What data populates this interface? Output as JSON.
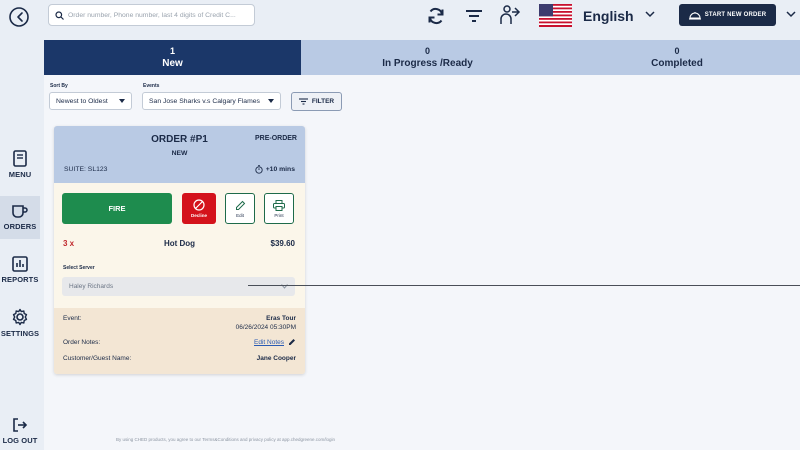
{
  "search": {
    "placeholder": "Order number, Phone number, last 4 digits of Credit C..."
  },
  "header": {
    "language": "English",
    "start_order_label": "START NEW ORDER"
  },
  "sidebar": {
    "items": [
      {
        "label": "MENU",
        "icon": "book-icon"
      },
      {
        "label": "ORDERS",
        "icon": "coffee-cup-icon"
      },
      {
        "label": "REPORTS",
        "icon": "bar-chart-icon"
      },
      {
        "label": "SETTINGS",
        "icon": "gear-icon"
      },
      {
        "label": "LOG OUT",
        "icon": "logout-icon"
      }
    ]
  },
  "tabs": [
    {
      "count": "1",
      "label": "New"
    },
    {
      "count": "0",
      "label": "In Progress /Ready"
    },
    {
      "count": "0",
      "label": "Completed"
    }
  ],
  "filters": {
    "sort_label": "Sort By",
    "sort_value": "Newest to Oldest",
    "events_label": "Events",
    "events_value": "San Jose Sharks v.s Calgary Flames",
    "filter_button": "FILTER"
  },
  "order": {
    "number": "ORDER #P1",
    "type": "PRE-ORDER",
    "status": "NEW",
    "suite": "SUITE: SL123",
    "time": "+10 mins",
    "fire_label": "FIRE",
    "decline_label": "Decline",
    "edit_label": "Edit",
    "print_label": "Print",
    "item": {
      "qty": "3 x",
      "name": "Hot Dog",
      "price": "$39.60"
    },
    "server_label": "Select Server",
    "server_value": "Haley Richards",
    "event_label": "Event:",
    "event_name": "Eras Tour",
    "event_date": "06/26/2024 05:30PM",
    "notes_label": "Order Notes:",
    "edit_notes": "Edit Notes",
    "customer_label": "Customer/Guest Name:",
    "customer_name": "Jane Cooper"
  },
  "footer": {
    "terms": "By using CHED products, you agree to our Terms&Conditions and privacy policy at app.chedgreene.com/login"
  },
  "colors": {
    "navy": "#1b2a47",
    "tab_active": "#1b3769",
    "tab_inactive": "#b9cae4",
    "fire_green": "#1e8c4e",
    "decline_red": "#d4121b"
  }
}
